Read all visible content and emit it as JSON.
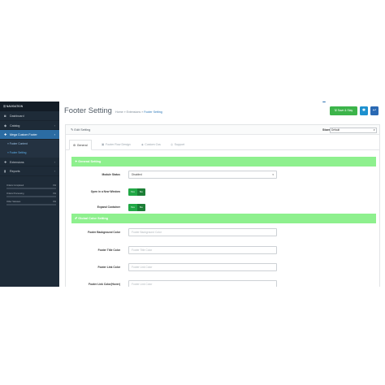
{
  "sidebar": {
    "nav_title": "NAVIGATION",
    "items": [
      {
        "label": "Dashboard",
        "icon": "dashboard-icon",
        "glyph": "◙",
        "has_chevron": false
      },
      {
        "label": "Catalog",
        "icon": "tag-icon",
        "glyph": "◆",
        "has_chevron": true
      },
      {
        "label": "Mega Custom Footer",
        "icon": "puzzle-icon",
        "glyph": "✚",
        "has_chevron": true,
        "active": true
      }
    ],
    "sub_items": [
      {
        "label": "» Footer Content"
      },
      {
        "label": "» Footer Setting",
        "current": true
      }
    ],
    "items2": [
      {
        "label": "Extensions",
        "icon": "puzzle-piece-icon",
        "glyph": "✚",
        "has_chevron": true
      },
      {
        "label": "Reports",
        "icon": "bar-chart-icon",
        "glyph": "▮",
        "has_chevron": true
      }
    ],
    "progress": [
      {
        "label": "Orders Completed",
        "value": "0%",
        "fraction": 0.0
      },
      {
        "label": "Orders Processing",
        "value": "0%",
        "fraction": 0.0
      },
      {
        "label": "Other Statuses",
        "value": "0%",
        "fraction": 0.0
      }
    ]
  },
  "header": {
    "title": "Footer Setting",
    "breadcrumb": [
      "Home",
      "Extensions",
      "Footer Setting"
    ],
    "breadcrumb_sep": "»",
    "save_label": "Save & Stay",
    "save_icon": "save-icon",
    "info_icon": "info-icon",
    "back_icon": "reply-icon"
  },
  "panel": {
    "title": "Edit Setting",
    "title_icon": "pencil-icon",
    "store_label": "Store",
    "store_value": "Default",
    "tabs": [
      {
        "label": "General",
        "icon": "gear-icon",
        "active": true
      },
      {
        "label": "Footer Row Design",
        "icon": "image-icon"
      },
      {
        "label": "Custom Css",
        "icon": "code-icon"
      },
      {
        "label": "Support",
        "icon": "support-icon"
      }
    ]
  },
  "general": {
    "section_title": "General Setting",
    "module_status_label": "Module Status",
    "module_status_value": "Disabled",
    "new_window_label": "Open in a New Window",
    "expand_label": "Expand Container",
    "yes": "Yes",
    "no": "No"
  },
  "color_section": {
    "section_title": "Global Color Setting",
    "fields": [
      {
        "label": "Footer Background Color",
        "placeholder": "Footer Background Color"
      },
      {
        "label": "Footer Title Color",
        "placeholder": "Footer Title Color"
      },
      {
        "label": "Footer Link Color",
        "placeholder": "Footer Link Color"
      },
      {
        "label": "Footer Link Color(Hover)",
        "placeholder": "Footer Link Color"
      }
    ]
  },
  "colors": {
    "sidebar_bg": "#1e2b38",
    "active_nav": "#2b6ca3",
    "section_green": "#8ef08e",
    "save_green": "#3cb44a",
    "info_blue": "#1e91cf",
    "toggle_green": "#21a845"
  }
}
